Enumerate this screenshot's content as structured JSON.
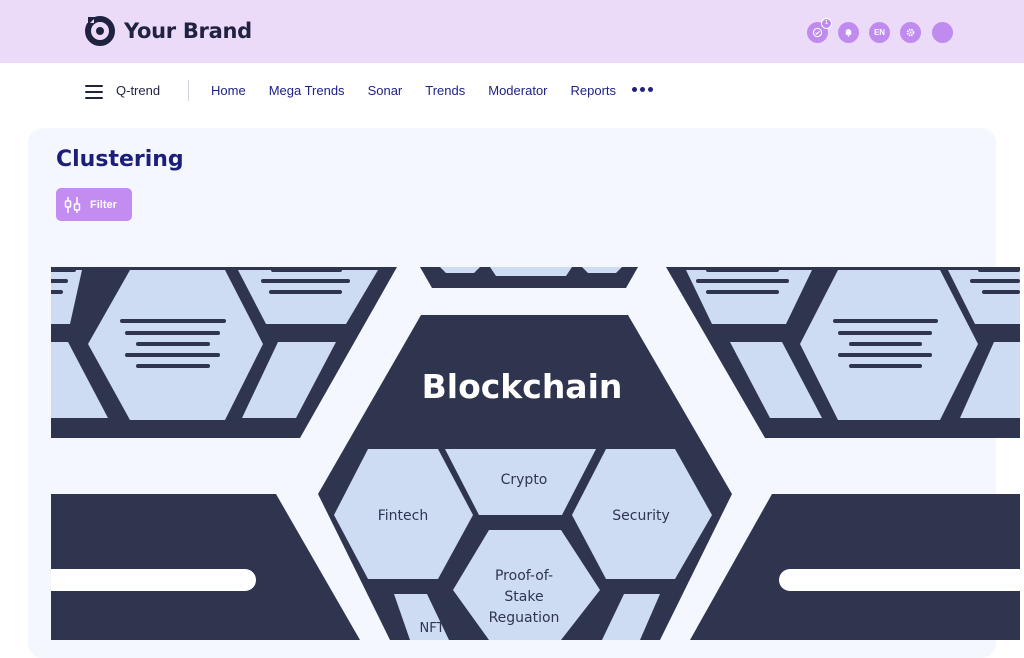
{
  "brand": {
    "name": "Your Brand"
  },
  "header": {
    "notification_count": "1",
    "language": "EN",
    "icons": [
      "check-circle-icon",
      "bell-icon",
      "language-icon",
      "gear-icon",
      "avatar"
    ]
  },
  "nav": {
    "product": "Q-trend",
    "links": [
      "Home",
      "Mega Trends",
      "Sonar",
      "Trends",
      "Moderator",
      "Reports"
    ],
    "more_icon": "more-dots-icon"
  },
  "page": {
    "title": "Clustering",
    "filter_label": "Filter"
  },
  "diagram": {
    "center_title": "Blockchain",
    "cells": {
      "crypto": "Crypto",
      "fintech": "Fintech",
      "security": "Security",
      "pos_line1": "Proof-of-",
      "pos_line2": "Stake",
      "pos_line3": "Reguation",
      "nft": "NFT"
    }
  },
  "colors": {
    "header_bg": "#ecdaf9",
    "accent": "#bf8bef",
    "dark_navy": "#30354f",
    "cell_fill": "#cddbf3",
    "panel_bg": "#f4f7fd",
    "title": "#1c1f7a"
  }
}
